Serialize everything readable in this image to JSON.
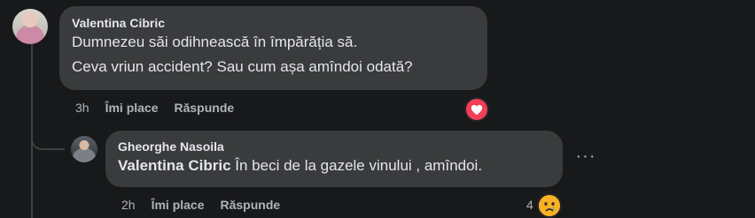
{
  "comment": {
    "author": "Valentina Cibric",
    "lines": [
      "Dumnezeu săi odihnească în împărăția să.",
      "Ceva vriun accident? Sau cum așa amîndoi odată?"
    ],
    "time": "3h",
    "like_label": "Îmi place",
    "reply_label": "Răspunde",
    "reaction": "heart-icon",
    "colors": {
      "heart": "#f33e58",
      "bubble": "#3a3b3c",
      "background": "#18191a"
    }
  },
  "reply": {
    "author": "Gheorghe Nasoila",
    "mention": "Valentina Cibric",
    "text": " În beci de la gazele vinului , amîndoi.",
    "time": "2h",
    "like_label": "Îmi place",
    "reply_label": "Răspunde",
    "more_label": "···",
    "reaction_count": "4",
    "reaction": "crying-face-icon"
  }
}
